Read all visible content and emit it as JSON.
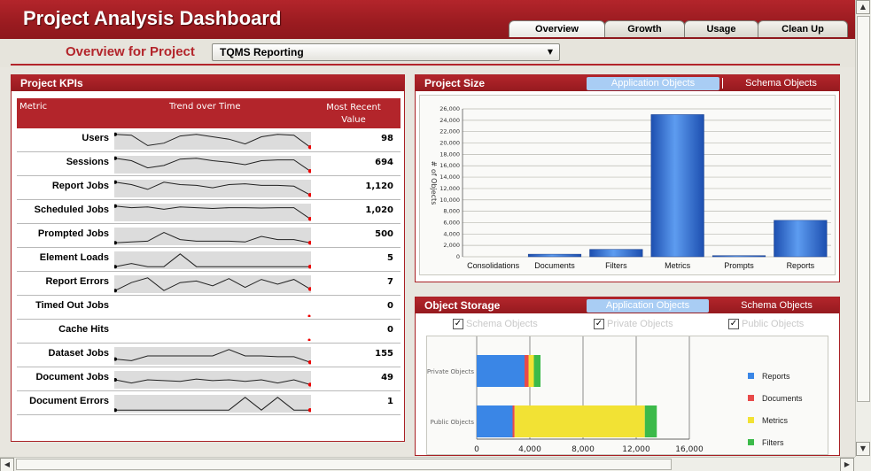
{
  "app": {
    "title": "Project Analysis Dashboard"
  },
  "tabs": [
    {
      "label": "Overview",
      "active": true
    },
    {
      "label": "Growth",
      "active": false
    },
    {
      "label": "Usage",
      "active": false
    },
    {
      "label": "Clean Up",
      "active": false
    }
  ],
  "overview": {
    "label": "Overview for Project",
    "project": "TQMS Reporting"
  },
  "kpi": {
    "title": "Project KPIs",
    "columns": {
      "metric": "Metric",
      "trend": "Trend over Time",
      "recent": "Most Recent Value"
    },
    "rows": [
      {
        "label": "Users",
        "value": "98",
        "spark": [
          0.9,
          0.85,
          0.2,
          0.35,
          0.8,
          0.9,
          0.75,
          0.6,
          0.3,
          0.75,
          0.9,
          0.85,
          0.1
        ]
      },
      {
        "label": "Sessions",
        "value": "694",
        "spark": [
          0.9,
          0.75,
          0.3,
          0.45,
          0.85,
          0.9,
          0.75,
          0.65,
          0.5,
          0.75,
          0.8,
          0.8,
          0.1
        ]
      },
      {
        "label": "Report Jobs",
        "value": "1,120",
        "spark": [
          0.9,
          0.75,
          0.45,
          0.9,
          0.75,
          0.7,
          0.55,
          0.75,
          0.8,
          0.7,
          0.7,
          0.65,
          0.1
        ]
      },
      {
        "label": "Scheduled Jobs",
        "value": "1,020",
        "spark": [
          0.9,
          0.8,
          0.85,
          0.7,
          0.85,
          0.8,
          0.75,
          0.8,
          0.8,
          0.78,
          0.8,
          0.8,
          0.1
        ]
      },
      {
        "label": "Prompted Jobs",
        "value": "500",
        "spark": [
          0.1,
          0.15,
          0.2,
          0.75,
          0.3,
          0.2,
          0.2,
          0.2,
          0.15,
          0.5,
          0.3,
          0.3,
          0.1
        ]
      },
      {
        "label": "Element Loads",
        "value": "5",
        "spark": [
          0.1,
          0.3,
          0.1,
          0.1,
          0.9,
          0.1,
          0.1,
          0.1,
          0.1,
          0.1,
          0.1,
          0.1,
          0.1
        ]
      },
      {
        "label": "Report Errors",
        "value": "7",
        "spark": [
          0.1,
          0.6,
          0.9,
          0.1,
          0.6,
          0.7,
          0.4,
          0.85,
          0.3,
          0.8,
          0.5,
          0.8,
          0.2
        ]
      },
      {
        "label": "Timed Out Jobs",
        "value": "0",
        "spark": []
      },
      {
        "label": "Cache Hits",
        "value": "0",
        "spark": []
      },
      {
        "label": "Dataset Jobs",
        "value": "155",
        "spark": [
          0.3,
          0.2,
          0.5,
          0.5,
          0.5,
          0.5,
          0.5,
          0.9,
          0.5,
          0.5,
          0.45,
          0.45,
          0.1
        ]
      },
      {
        "label": "Document Jobs",
        "value": "49",
        "spark": [
          0.5,
          0.3,
          0.5,
          0.45,
          0.4,
          0.55,
          0.45,
          0.5,
          0.4,
          0.5,
          0.3,
          0.5,
          0.2
        ]
      },
      {
        "label": "Document Errors",
        "value": "1",
        "spark": [
          0.1,
          0.1,
          0.1,
          0.1,
          0.1,
          0.1,
          0.1,
          0.1,
          0.9,
          0.1,
          0.9,
          0.1,
          0.1
        ]
      }
    ]
  },
  "size": {
    "title": "Project Size",
    "toggle_on": "Application Objects",
    "toggle_off": "Schema Objects"
  },
  "storage": {
    "title": "Object Storage",
    "toggle_on": "Application Objects",
    "toggle_off": "Schema Objects",
    "checkboxes": [
      "Schema Objects",
      "Private Objects",
      "Public Objects"
    ]
  },
  "chart_data": [
    {
      "type": "bar",
      "ylabel": "# of Objects",
      "ylim": [
        0,
        26000
      ],
      "yticks": [
        "0",
        "2,000",
        "4,000",
        "6,000",
        "8,000",
        "10,000",
        "12,000",
        "14,000",
        "16,000",
        "18,000",
        "20,000",
        "22,000",
        "24,000",
        "26,000"
      ],
      "categories": [
        "Consolidations",
        "Documents",
        "Filters",
        "Metrics",
        "Prompts",
        "Reports"
      ],
      "values": [
        0,
        450,
        1300,
        25000,
        200,
        6400
      ],
      "grid": true,
      "color": "#2f6ed1"
    },
    {
      "type": "bar",
      "orientation": "horizontal",
      "stacked": true,
      "categories": [
        "Private Objects",
        "Public Objects"
      ],
      "xticks": [
        "0",
        "4,000",
        "8,000",
        "12,000",
        "16,000"
      ],
      "xlim": [
        0,
        16000
      ],
      "series": [
        {
          "name": "Reports",
          "color": "#3a86e6",
          "values": [
            3600,
            2700
          ]
        },
        {
          "name": "Documents",
          "color": "#e84a4a",
          "values": [
            300,
            150
          ]
        },
        {
          "name": "Metrics",
          "color": "#f2e234",
          "values": [
            400,
            9800
          ]
        },
        {
          "name": "Filters",
          "color": "#3cba4a",
          "values": [
            500,
            900
          ]
        }
      ],
      "legend": "right",
      "grid": true
    }
  ]
}
